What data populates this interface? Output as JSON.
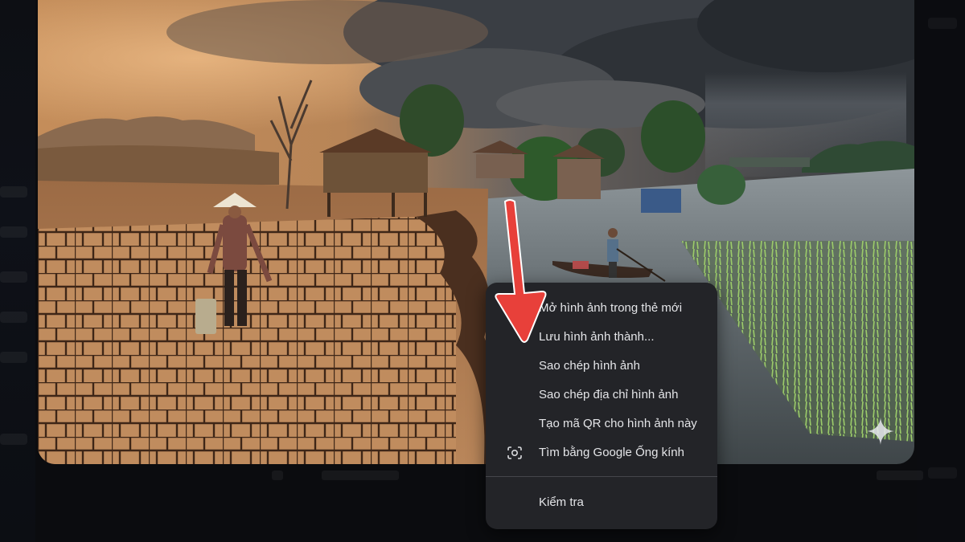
{
  "context_menu": {
    "items": [
      {
        "label": "Mở hình ảnh trong thẻ mới"
      },
      {
        "label": "Lưu hình ảnh thành..."
      },
      {
        "label": "Sao chép hình ảnh"
      },
      {
        "label": "Sao chép địa chỉ hình ảnh"
      },
      {
        "label": "Tạo mã QR cho hình ảnh này"
      },
      {
        "label": "Tìm bằng Google Ống kính",
        "icon": "google-lens-icon"
      }
    ],
    "inspect_label": "Kiểm tra"
  },
  "colors": {
    "menu_background": "#232428",
    "menu_text": "#e4e5e8",
    "arrow": "#e8403a",
    "page_background": "#0b0c0f"
  },
  "icons": {
    "lens": "google-lens-icon",
    "sparkle": "sparkle-icon",
    "arrow": "red-arrow-icon"
  }
}
